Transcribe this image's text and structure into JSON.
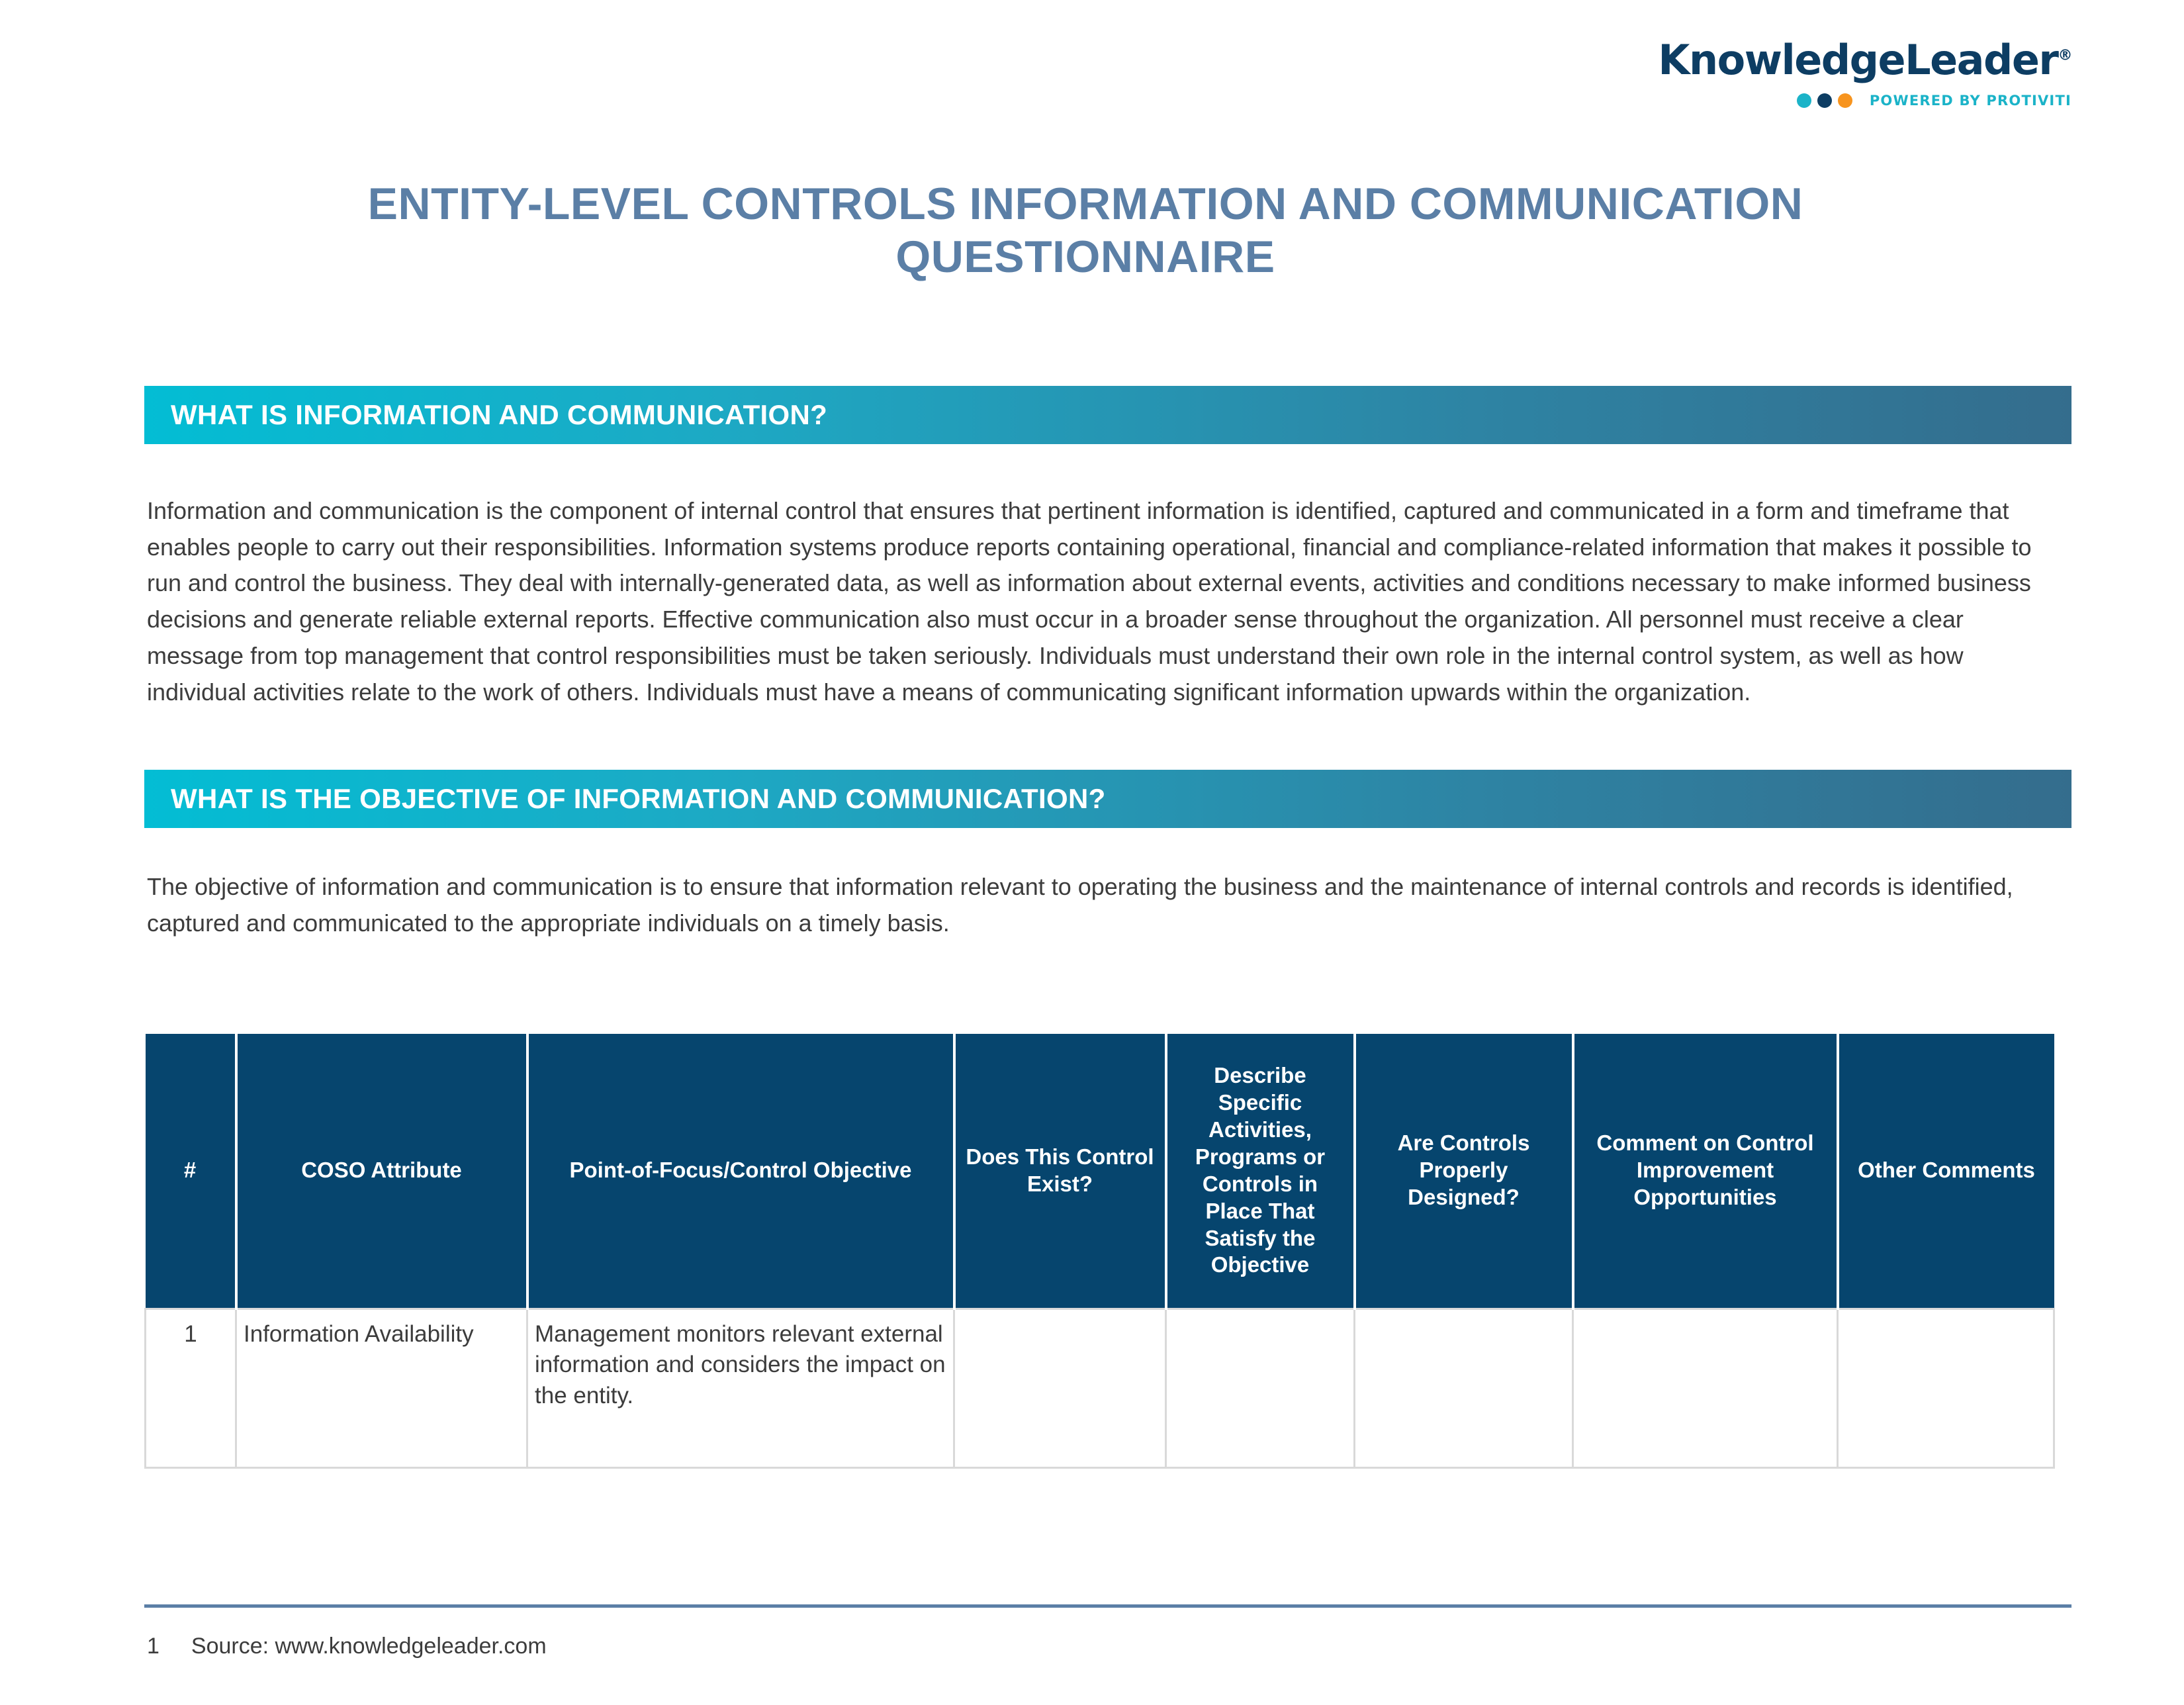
{
  "brand": {
    "logo_text": "KnowledgeLeader",
    "logo_registered": "®",
    "tagline": "POWERED BY PROTIVITI",
    "dot_colors": [
      "#1bb3c8",
      "#0d3d63",
      "#f7941e"
    ],
    "logo_color": "#0d3d63",
    "tagline_color": "#1bb3c8"
  },
  "document": {
    "title": "ENTITY-LEVEL CONTROLS INFORMATION AND COMMUNICATION QUESTIONNAIRE",
    "title_color": "#5b7fa6"
  },
  "sections": [
    {
      "heading": "WHAT IS INFORMATION AND COMMUNICATION?",
      "body": "Information and communication is the component of internal control that ensures that pertinent information is identified, captured and communicated in a form and timeframe that enables people to carry out their responsibilities. Information systems produce reports containing operational, financial and compliance-related information that makes it possible to run and control the business. They deal with internally-generated data, as well as information about external events, activities and conditions necessary to make informed business decisions and generate reliable external reports. Effective communication also must occur in a broader sense throughout the organization. All personnel must receive a clear message from top management that control responsibilities must be taken seriously. Individuals must understand their own role in the internal control system, as well as how individual activities relate to the work of others. Individuals must have a means of communicating significant information upwards within the organization."
    },
    {
      "heading": "WHAT IS THE OBJECTIVE OF INFORMATION AND COMMUNICATION?",
      "body": "The objective of information and communication is to ensure that information relevant to operating the business and the maintenance of internal controls and records is identified, captured and communicated to the appropriate individuals on a timely basis."
    }
  ],
  "banner_colors": {
    "gradient_start": "#03bdd4",
    "gradient_end": "#346d8d",
    "text": "#ffffff"
  },
  "table": {
    "header_background": "#06456e",
    "border_color": "#d9d9d9",
    "columns": [
      "#",
      "COSO Attribute",
      "Point-of-Focus/Control Objective",
      "Does This Control Exist?",
      "Describe Specific Activities, Programs or Controls in Place That Satisfy the Objective",
      "Are Controls Properly Designed?",
      "Comment on Control Improvement Opportunities",
      "Other Comments"
    ],
    "rows": [
      {
        "num": "1",
        "attribute": "Information Availability",
        "objective": "Management monitors relevant external information and considers the impact on the entity.",
        "exists": "",
        "describe": "",
        "designed": "",
        "comment": "",
        "other": ""
      }
    ]
  },
  "footer": {
    "page_number": "1",
    "source": "Source: www.knowledgeleader.com",
    "rule_color": "#5b7fa6"
  }
}
